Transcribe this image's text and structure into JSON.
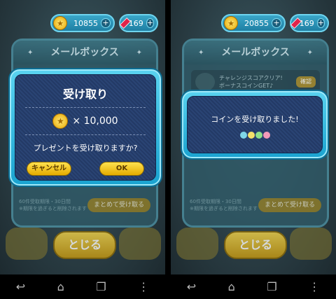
{
  "left": {
    "coins": "10855",
    "rubies": "169",
    "mailbox_title": "メールボックス",
    "dialog": {
      "title": "受け取り",
      "amount": "× 10,000",
      "question": "プレゼントを受け取りますか?",
      "cancel_label": "キャンセル",
      "ok_label": "OK"
    },
    "footer_note_1": "60件受取期限・30日間",
    "footer_note_2": "※期限を過ぎると削除されます",
    "collect_all_label": "まとめて受け取る",
    "close_label": "とじる"
  },
  "right": {
    "coins": "20855",
    "rubies": "169",
    "mailbox_title": "メールボックス",
    "mail_item_text_1": "チャレンジスコアクリア!",
    "mail_item_text_2": "ボーナスコインGET♪",
    "mail_confirm_label": "確認",
    "dialog_message": "コインを受け取りました!",
    "footer_note_1": "60件受取期限・30日間",
    "footer_note_2": "※期限を過ぎると削除されます",
    "collect_all_label": "まとめて受け取る",
    "close_label": "とじる"
  },
  "icons": {
    "coin": "coin-icon",
    "ruby": "ruby-icon",
    "plus": "plus-icon",
    "back": "back-icon",
    "home": "home-icon",
    "recent": "recent-apps-icon",
    "menu": "menu-icon"
  },
  "glyphs": {
    "plus": "+",
    "back": "↩",
    "home": "⌂",
    "recent": "❐",
    "menu": "⋮",
    "sparkle": "✦",
    "coin": "★"
  },
  "colors": {
    "dialog_border": "#1aa3d0",
    "button_yellow": "#ffe14f",
    "ruby": "#e0234a"
  }
}
